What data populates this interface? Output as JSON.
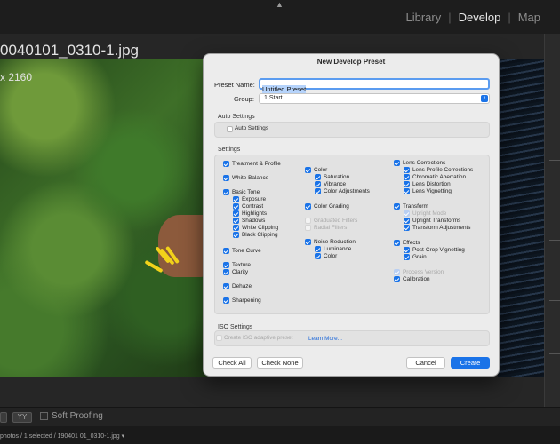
{
  "app": {
    "modules": [
      "Library",
      "Develop",
      "Map"
    ],
    "active_module": "Develop",
    "file_title": "0040101_0310-1.jpg",
    "dimensions": "x 2160",
    "soft_proofing_label": "Soft Proofing",
    "filmstrip_info": "photos / 1 selected / 190401 01_0310-1.jpg ▾"
  },
  "dialog": {
    "title": "New Develop Preset",
    "preset_name_label": "Preset Name:",
    "preset_name_value": "Untitled Preset",
    "group_label": "Group:",
    "group_value": "1 Start",
    "auto_settings_section": "Auto Settings",
    "auto_settings_label": "Auto Settings",
    "settings_section": "Settings",
    "iso_section": "ISO Settings",
    "iso_checkbox_label": "Create ISO adaptive preset",
    "learn_more": "Learn More...",
    "buttons": {
      "check_all": "Check All",
      "check_none": "Check None",
      "cancel": "Cancel",
      "create": "Create"
    },
    "settings_col1": [
      {
        "label": "Treatment & Profile",
        "state": "on",
        "indent": 0
      },
      {
        "label": "White Balance",
        "state": "on",
        "indent": 0
      },
      {
        "label": "Basic Tone",
        "state": "on",
        "indent": 0
      },
      {
        "label": "Exposure",
        "state": "on",
        "indent": 1
      },
      {
        "label": "Contrast",
        "state": "on",
        "indent": 1
      },
      {
        "label": "Highlights",
        "state": "on",
        "indent": 1
      },
      {
        "label": "Shadows",
        "state": "on",
        "indent": 1
      },
      {
        "label": "White Clipping",
        "state": "on",
        "indent": 1
      },
      {
        "label": "Black Clipping",
        "state": "on",
        "indent": 1
      },
      {
        "label": "Tone Curve",
        "state": "on",
        "indent": 0
      },
      {
        "label": "Texture",
        "state": "on",
        "indent": 0
      },
      {
        "label": "Clarity",
        "state": "on",
        "indent": 0
      },
      {
        "label": "Dehaze",
        "state": "on",
        "indent": 0
      },
      {
        "label": "Sharpening",
        "state": "on",
        "indent": 0
      }
    ],
    "settings_col2": [
      {
        "label": "Color",
        "state": "on",
        "indent": 0
      },
      {
        "label": "Saturation",
        "state": "on",
        "indent": 1
      },
      {
        "label": "Vibrance",
        "state": "on",
        "indent": 1
      },
      {
        "label": "Color Adjustments",
        "state": "on",
        "indent": 1
      },
      {
        "label": "Color Grading",
        "state": "on",
        "indent": 0
      },
      {
        "label": "Graduated Filters",
        "state": "disabled",
        "indent": 0
      },
      {
        "label": "Radial Filters",
        "state": "disabled",
        "indent": 0
      },
      {
        "label": "Noise Reduction",
        "state": "on",
        "indent": 0
      },
      {
        "label": "Luminance",
        "state": "on",
        "indent": 1
      },
      {
        "label": "Color",
        "state": "on",
        "indent": 1
      }
    ],
    "settings_col3": [
      {
        "label": "Lens Corrections",
        "state": "on",
        "indent": 0
      },
      {
        "label": "Lens Profile Corrections",
        "state": "on",
        "indent": 1
      },
      {
        "label": "Chromatic Aberration",
        "state": "on",
        "indent": 1
      },
      {
        "label": "Lens Distortion",
        "state": "on",
        "indent": 1
      },
      {
        "label": "Lens Vignetting",
        "state": "on",
        "indent": 1
      },
      {
        "label": "Transform",
        "state": "on",
        "indent": 0
      },
      {
        "label": "Upright Mode",
        "state": "disabled-on",
        "indent": 1
      },
      {
        "label": "Upright Transforms",
        "state": "on",
        "indent": 1
      },
      {
        "label": "Transform Adjustments",
        "state": "on",
        "indent": 1
      },
      {
        "label": "Effects",
        "state": "on",
        "indent": 0
      },
      {
        "label": "Post-Crop Vignetting",
        "state": "on",
        "indent": 1
      },
      {
        "label": "Grain",
        "state": "on",
        "indent": 1
      },
      {
        "label": "Process Version",
        "state": "disabled-on",
        "indent": 0
      },
      {
        "label": "Calibration",
        "state": "on",
        "indent": 0
      }
    ]
  },
  "colors": {
    "accent": "#1a73e8",
    "dialog_bg": "#ececec",
    "app_bg": "#1b1b1b"
  }
}
